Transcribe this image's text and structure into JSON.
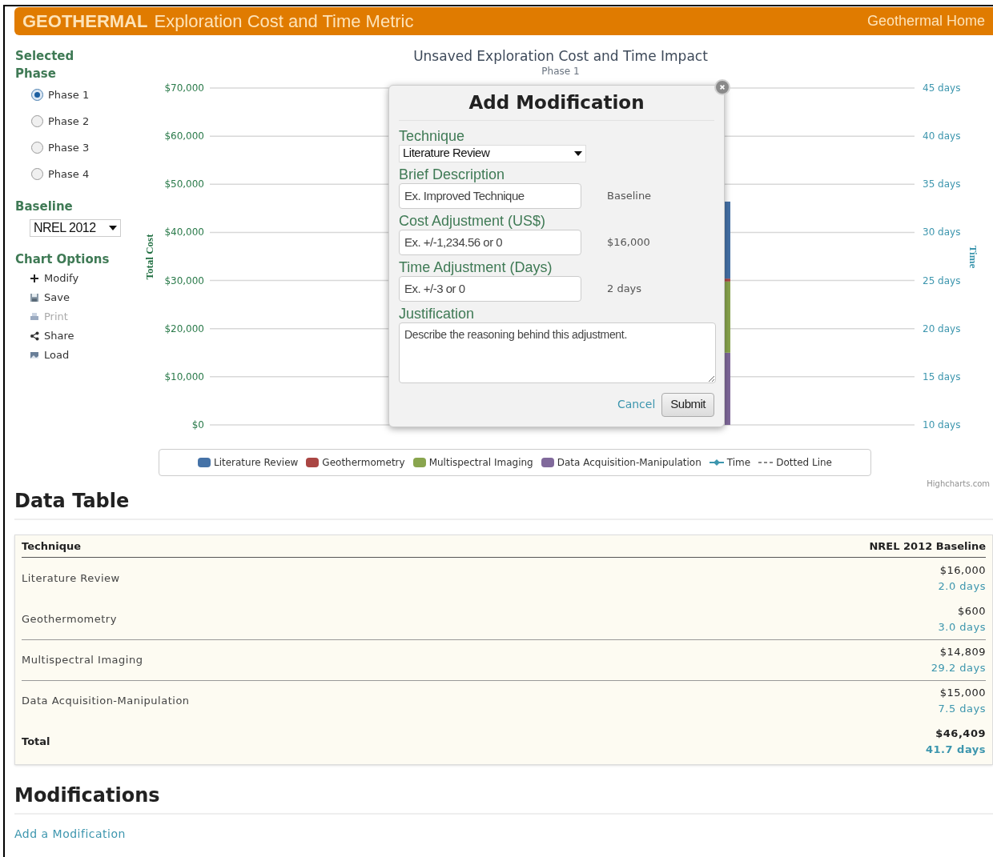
{
  "header": {
    "brand": "GEOTHERMAL",
    "title": "Exploration Cost and Time Metric",
    "home_link": "Geothermal Home"
  },
  "sidebar": {
    "phase_heading": "Selected Phase",
    "phases": [
      {
        "label": "Phase 1",
        "selected": true
      },
      {
        "label": "Phase 2",
        "selected": false
      },
      {
        "label": "Phase 3",
        "selected": false
      },
      {
        "label": "Phase 4",
        "selected": false
      }
    ],
    "baseline_heading": "Baseline",
    "baseline_value": "NREL 2012",
    "options_heading": "Chart Options",
    "options": [
      {
        "label": "Modify",
        "disabled": false
      },
      {
        "label": "Save",
        "disabled": false
      },
      {
        "label": "Print",
        "disabled": true
      },
      {
        "label": "Share",
        "disabled": false
      },
      {
        "label": "Load",
        "disabled": false
      }
    ]
  },
  "chart": {
    "title": "Unsaved Exploration Cost and Time Impact",
    "subtitle": "Phase 1",
    "y2axis_title": "Time",
    "chart_data": {
      "type": "bar",
      "stacked": true,
      "grid": true,
      "ylabel": "Total Cost",
      "ylim": [
        0,
        70000
      ],
      "yticks": [
        {
          "value": 0,
          "label": "$0"
        },
        {
          "value": 10000,
          "label": "$10,000"
        },
        {
          "value": 20000,
          "label": "$20,000"
        },
        {
          "value": 30000,
          "label": "$30,000"
        },
        {
          "value": 40000,
          "label": "$40,000"
        },
        {
          "value": 50000,
          "label": "$50,000"
        },
        {
          "value": 60000,
          "label": "$60,000"
        },
        {
          "value": 70000,
          "label": "$70,000"
        }
      ],
      "series": [
        {
          "name": "Literature Review",
          "color": "#4572a7",
          "values": [
            16000
          ]
        },
        {
          "name": "Geothermometry",
          "color": "#aa4643",
          "values": [
            600
          ]
        },
        {
          "name": "Multispectral Imaging",
          "color": "#89a54e",
          "values": [
            14800
          ]
        },
        {
          "name": "Data Acquisition-Manipulation",
          "color": "#80699b",
          "values": [
            15000
          ]
        }
      ]
    },
    "y2ticks": [
      "45 days",
      "40 days",
      "35 days",
      "30 days",
      "25 days",
      "20 days",
      "15 days",
      "10 days"
    ],
    "legend_extras": [
      {
        "label": "Time",
        "kind": "line",
        "color": "#3d96ae"
      },
      {
        "label": "Dotted Line",
        "kind": "dashed",
        "color": "#888888"
      }
    ],
    "credit": "Highcharts.com"
  },
  "modal": {
    "title": "Add Modification",
    "fields": [
      {
        "kind": "select",
        "label": "Technique",
        "value": "Literature Review"
      },
      {
        "kind": "input",
        "label": "Brief Description",
        "placeholder": "Ex. Improved Technique",
        "note": "Baseline"
      },
      {
        "kind": "input",
        "label": "Cost Adjustment (US$)",
        "placeholder": "Ex. +/-1,234.56 or 0",
        "note": "$16,000"
      },
      {
        "kind": "input",
        "label": "Time Adjustment (Days)",
        "placeholder": "Ex. +/-3 or 0",
        "note": "2 days"
      },
      {
        "kind": "textarea",
        "label": "Justification",
        "placeholder": "Describe the reasoning behind this adjustment."
      }
    ],
    "cancel": "Cancel",
    "submit": "Submit"
  },
  "data_table": {
    "heading": "Data Table",
    "columns": [
      "Technique",
      "NREL 2012 Baseline"
    ],
    "rows": [
      {
        "kind": "item",
        "technique": "Literature Review",
        "cost": "$16,000",
        "time": "2.0 days"
      },
      {
        "kind": "item",
        "technique": "Geothermometry",
        "cost": "$600",
        "time": "3.0 days"
      },
      {
        "kind": "item",
        "technique": "Multispectral Imaging",
        "cost": "$14,809",
        "time": "29.2 days"
      },
      {
        "kind": "item",
        "technique": "Data Acquisition-Manipulation",
        "cost": "$15,000",
        "time": "7.5 days"
      },
      {
        "kind": "total",
        "technique": "Total",
        "cost": "$46,409",
        "time": "41.7 days"
      }
    ]
  },
  "modifications": {
    "heading": "Modifications",
    "link": "Add a Modification"
  }
}
